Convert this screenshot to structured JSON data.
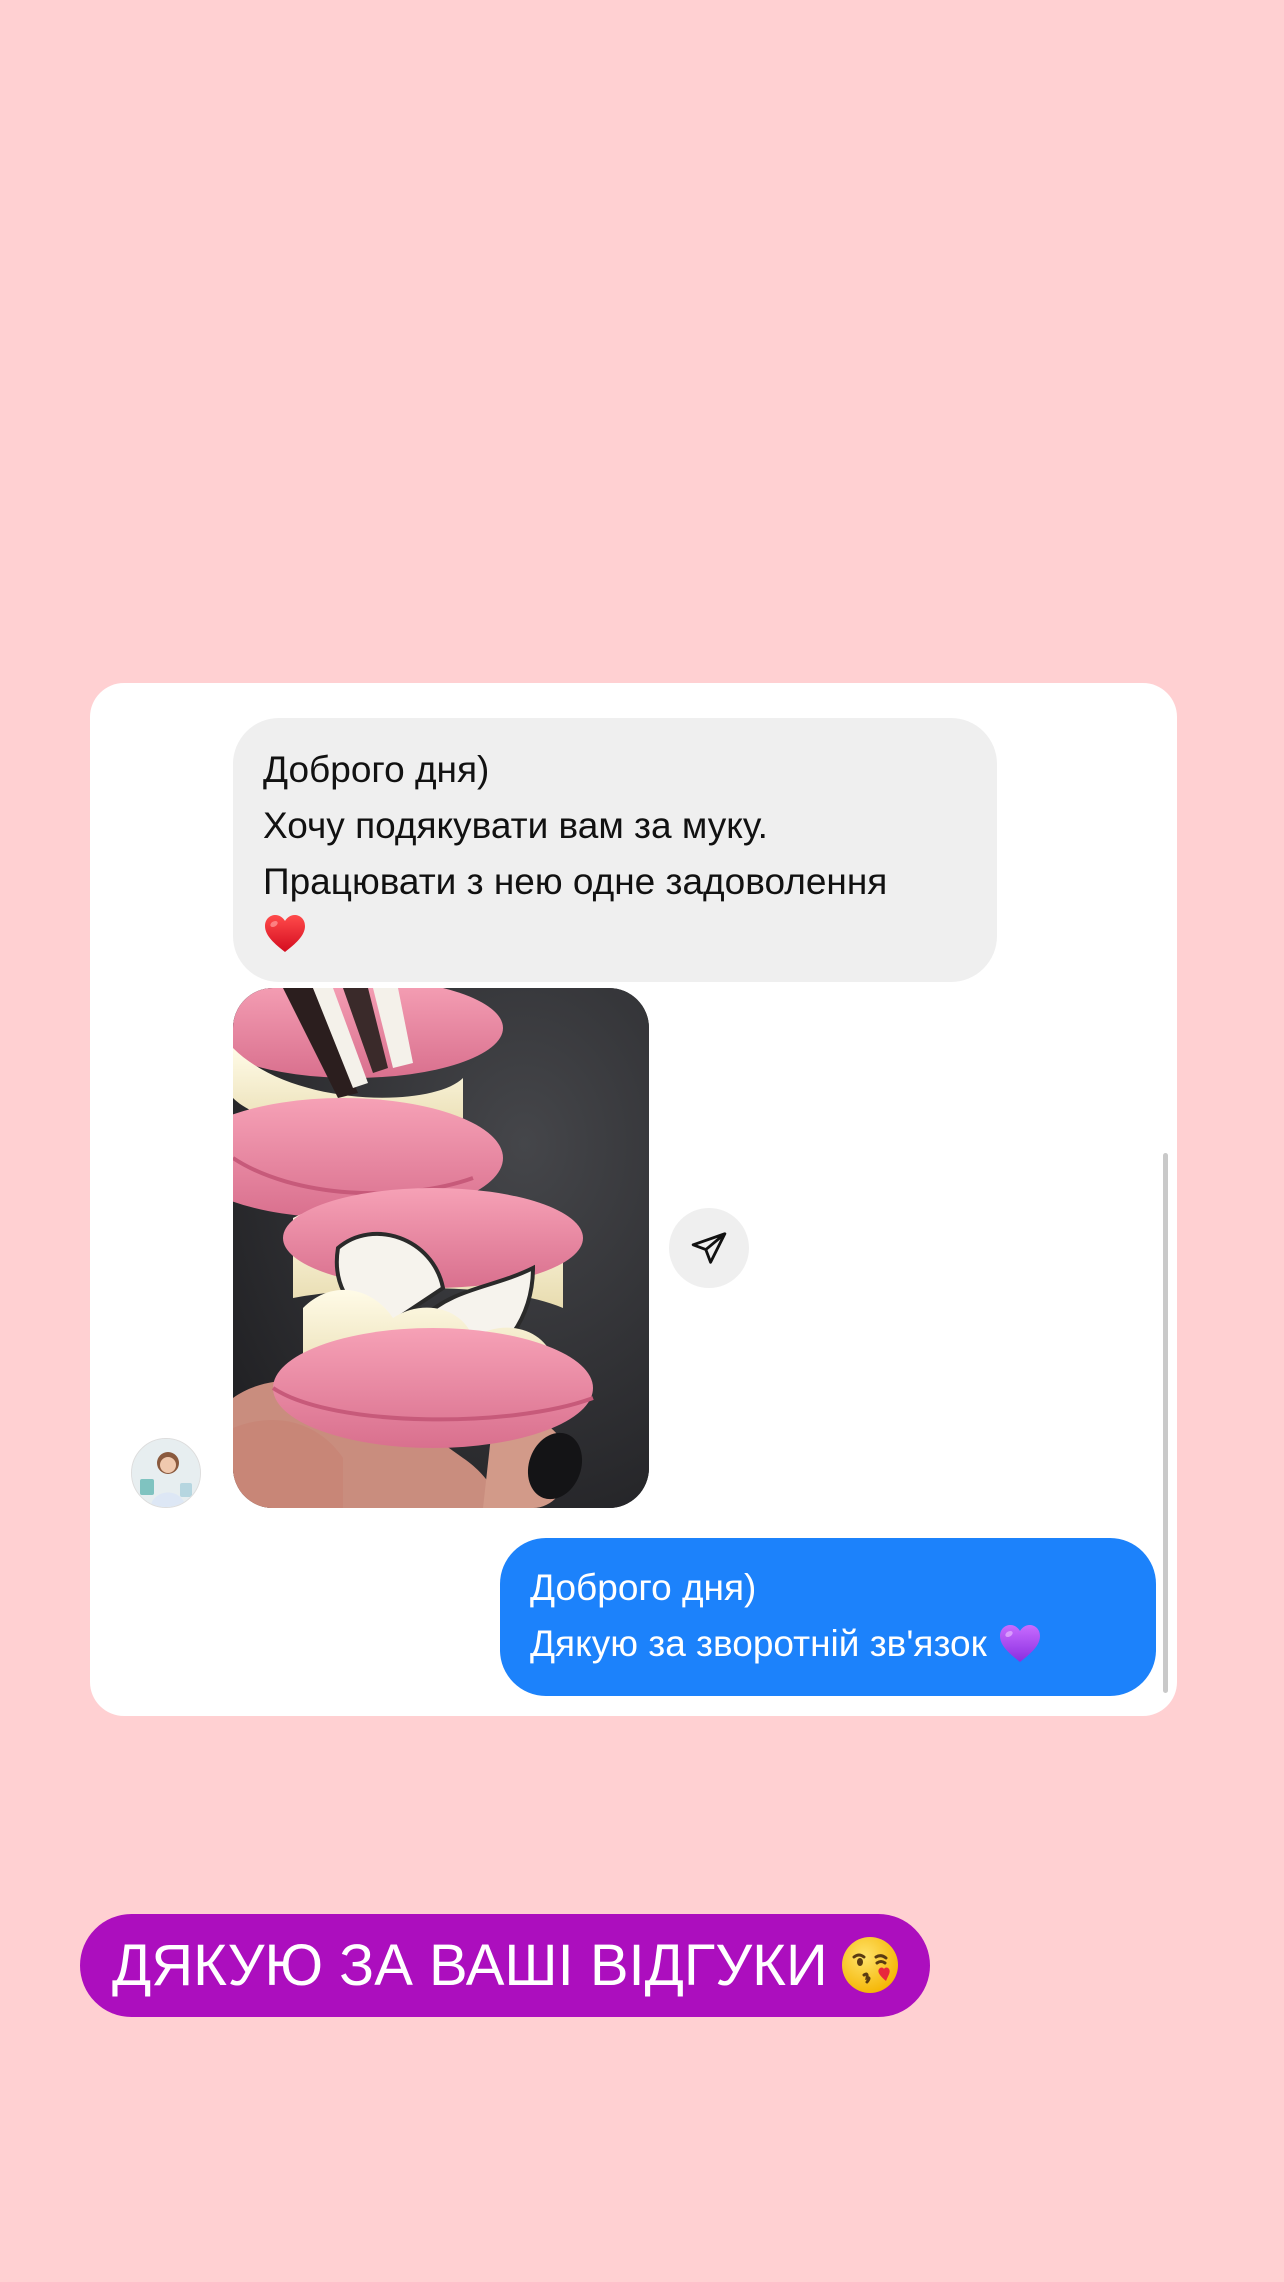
{
  "conversation": {
    "incoming": {
      "lines": [
        "Доброго дня)",
        "Хочу подякувати вам за муку.",
        "Працювати з нею одне задоволення"
      ],
      "emoji": "red-heart"
    },
    "photo": {
      "subject": "pink-macarons-photo"
    },
    "outgoing": {
      "lines": [
        "Доброго дня)",
        "Дякую за зворотній зв'язок"
      ],
      "emoji": "purple-heart"
    }
  },
  "caption": {
    "text": "ДЯКУЮ ЗА ВАШІ ВІДГУКИ"
  },
  "colors": {
    "background": "#FFD0D2",
    "incoming_bubble": "#EFEFEF",
    "outgoing_bubble": "#1C82FB",
    "caption_bg": "#AC0EBE"
  }
}
